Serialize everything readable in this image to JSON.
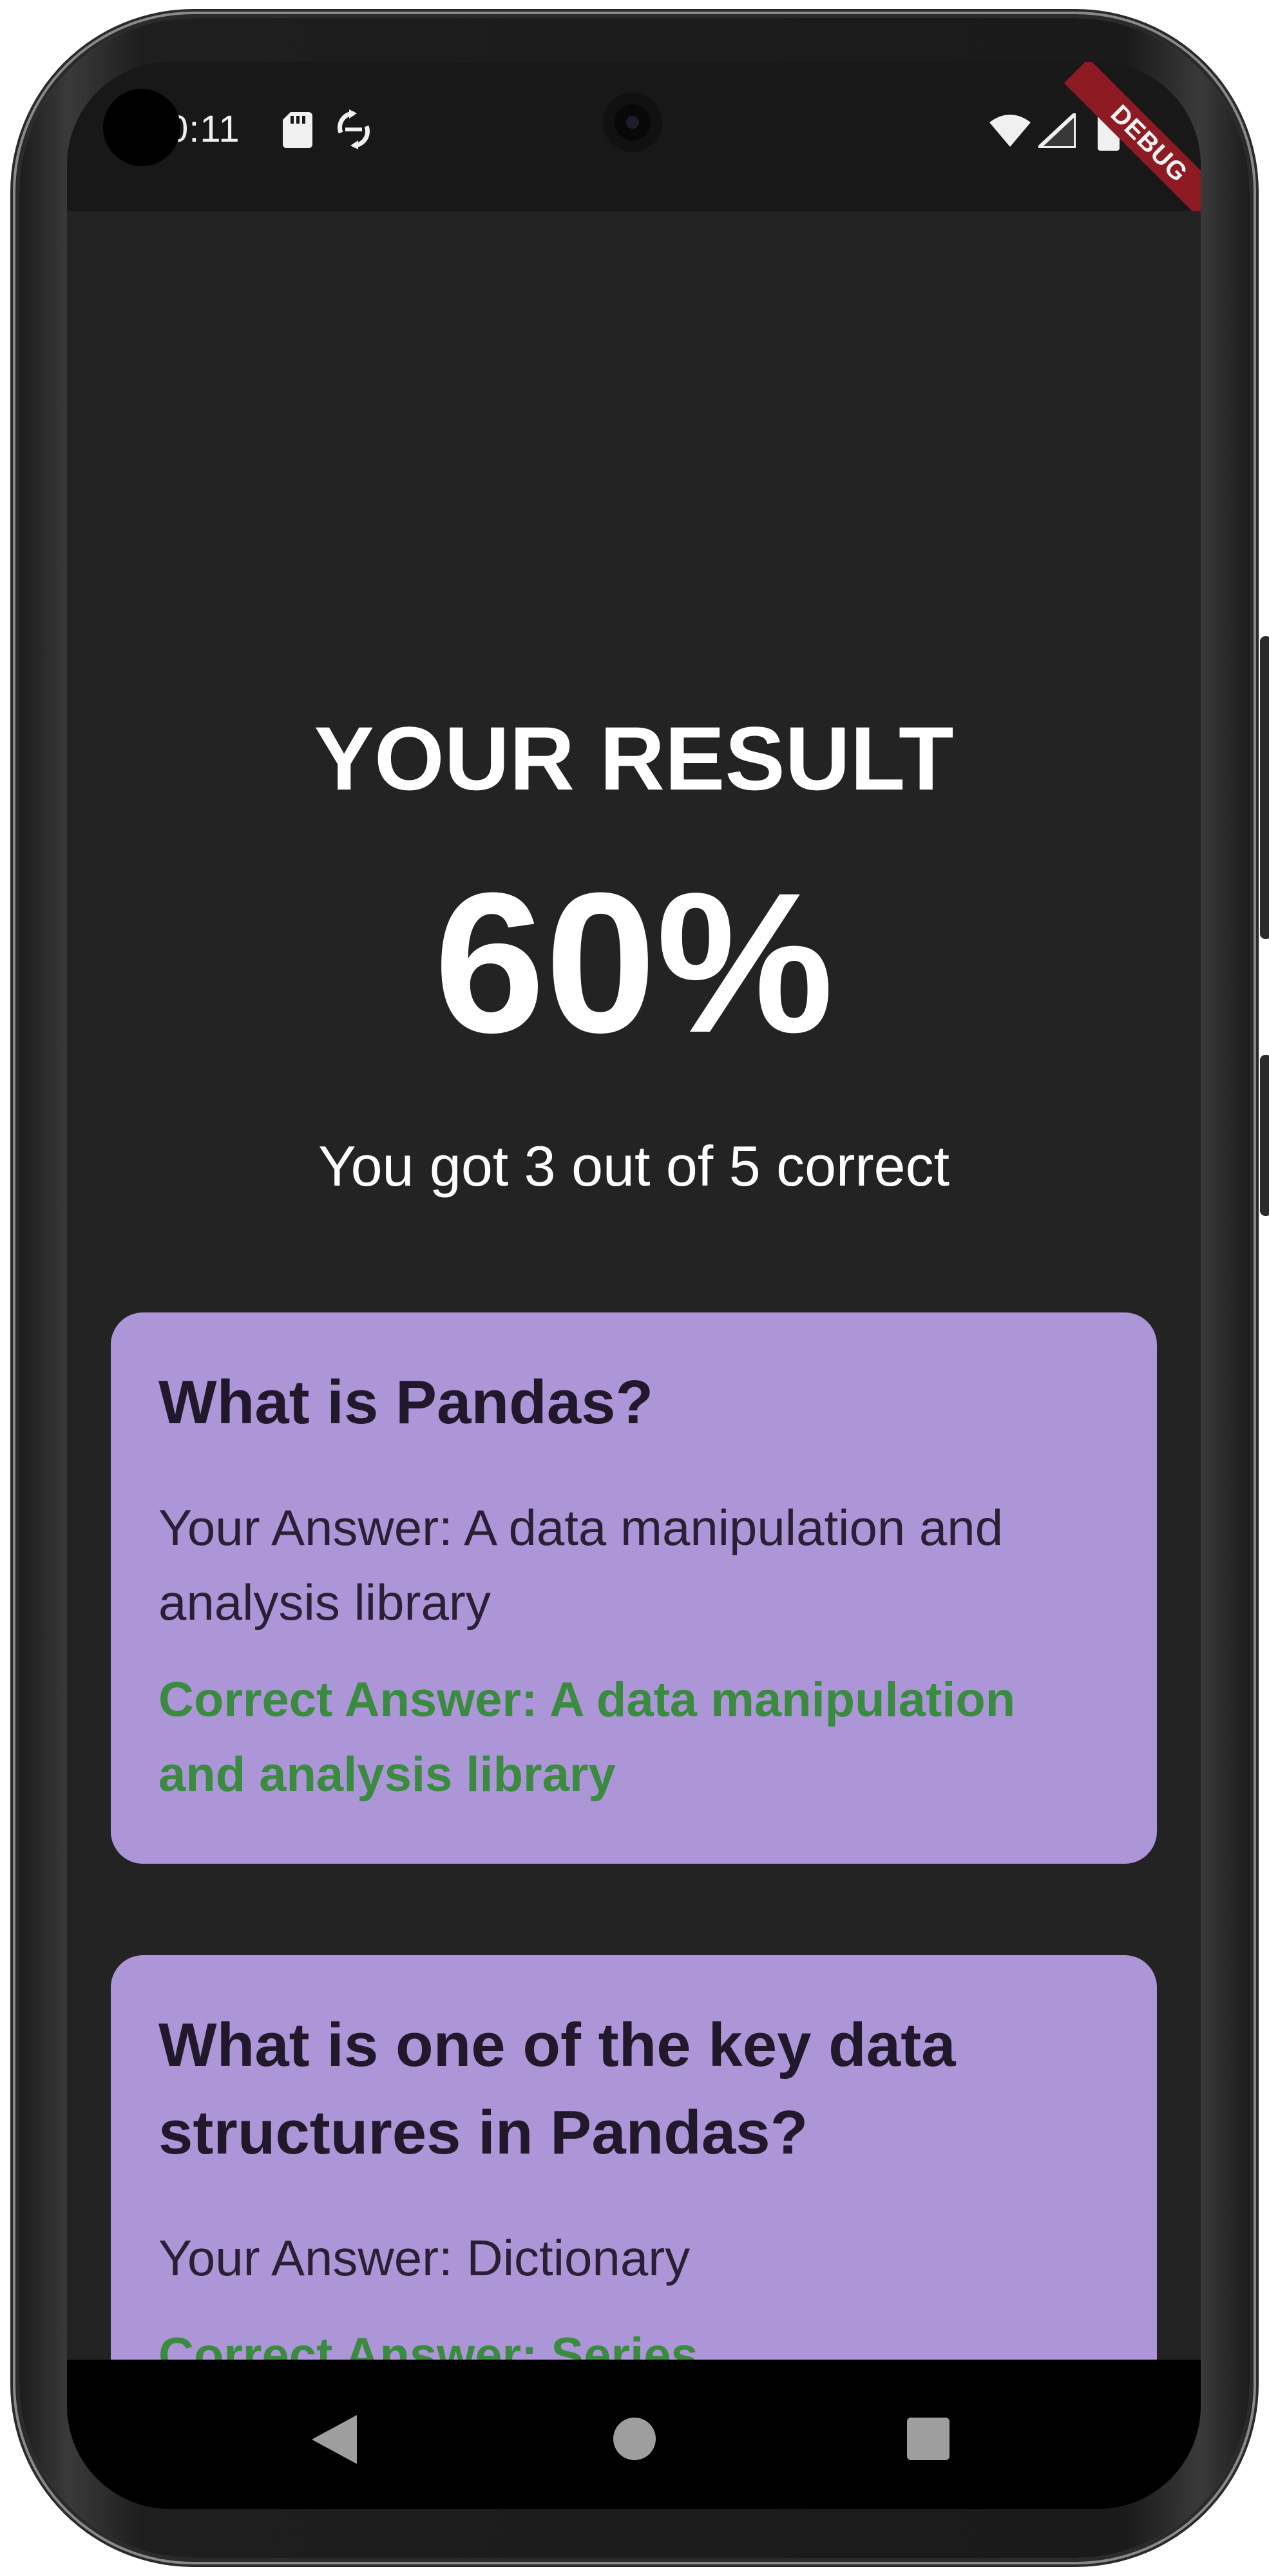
{
  "status_bar": {
    "time": "0:11",
    "debug_banner": "DEBUG",
    "icons": [
      "sd-card-icon",
      "sync-icon",
      "wifi-icon",
      "signal-icon",
      "battery-icon"
    ]
  },
  "result": {
    "title": "YOUR RESULT",
    "score": "60%",
    "summary": "You got 3 out of 5 correct"
  },
  "answers": [
    {
      "question": "What is Pandas?",
      "your_answer": "Your Answer: A data manipulation and analysis library",
      "correct_answer": "Correct Answer: A data manipulation and analysis library"
    },
    {
      "question": "What is one of the key data structures in Pandas?",
      "your_answer": "Your Answer: Dictionary",
      "correct_answer": "Correct Answer: Series"
    }
  ],
  "nav_bar": {
    "icons": [
      "back-icon",
      "home-icon",
      "recents-icon"
    ]
  },
  "colors": {
    "background": "#232323",
    "card": "#ad96d8",
    "correct_text": "#3a8a3f",
    "debug_banner": "#8e1a24"
  }
}
